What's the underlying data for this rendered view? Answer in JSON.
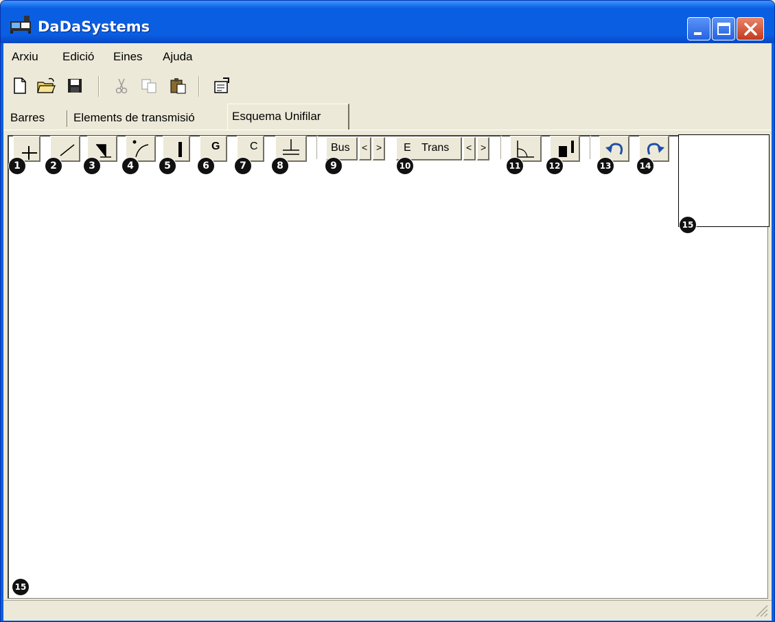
{
  "window": {
    "title": "DaDaSystems"
  },
  "menu": [
    "Arxiu",
    "Edició",
    "Eines",
    "Ajuda"
  ],
  "toolbar_icons": [
    "new-file-icon",
    "open-folder-icon",
    "save-icon",
    "cut-icon",
    "copy-icon",
    "paste-icon",
    "properties-icon"
  ],
  "tabs": [
    "Barres",
    "Elements de transmisió",
    "Esquema Unifilar"
  ],
  "active_tab": "Esquema Unifilar",
  "tools": {
    "bus_label": "Bus",
    "bus_prev": "<",
    "bus_next": ">",
    "trans_prefix": "E",
    "trans_label": "Trans",
    "trans_prev": "<",
    "trans_next": ">",
    "gen_letter": "G",
    "cap_letter": "C"
  },
  "badges": [
    "1",
    "2",
    "3",
    "4",
    "5",
    "6",
    "7",
    "8",
    "9",
    "10",
    "11",
    "12",
    "13",
    "14",
    "15",
    "15"
  ]
}
